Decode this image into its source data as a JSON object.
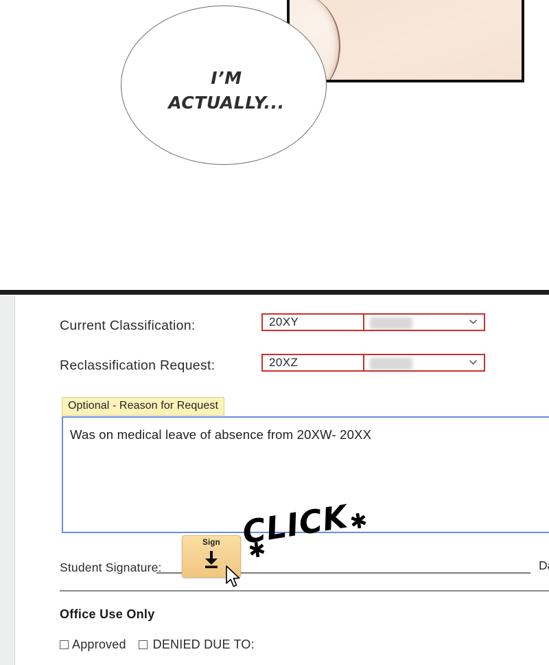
{
  "comic": {
    "speech_bubble_text": "I’M\nACTUALLY...",
    "panel_name": "comic-panel"
  },
  "form": {
    "fields": [
      {
        "label": "Current Classification:",
        "value": "20XY",
        "dropdown_value": "",
        "highlight_color": "#c9302c"
      },
      {
        "label": "Reclassification Request:",
        "value": "20XZ",
        "dropdown_value": "",
        "highlight_color": "#c9302c"
      }
    ],
    "reason_tooltip": "Optional - Reason for Request",
    "reason_value": "Was on medical leave of absence from 20XW- 20XX",
    "signature_label": "Student Signature:",
    "date_label": "Date",
    "sign_widget": {
      "label": "Sign",
      "icon": "download-arrow-icon"
    }
  },
  "annotation": {
    "click_text": "CLICK",
    "sparkle_left": "✱",
    "sparkle_right": "✱"
  },
  "office_use": {
    "heading": "Office Use Only",
    "approved_label": "Approved",
    "denied_label": "DENIED DUE TO:"
  },
  "colors": {
    "red_highlight": "#c9302c",
    "tooltip_yellow": "#fdf3b8",
    "textarea_blue": "#6b8ddb",
    "sign_amber": "#f6d294"
  }
}
